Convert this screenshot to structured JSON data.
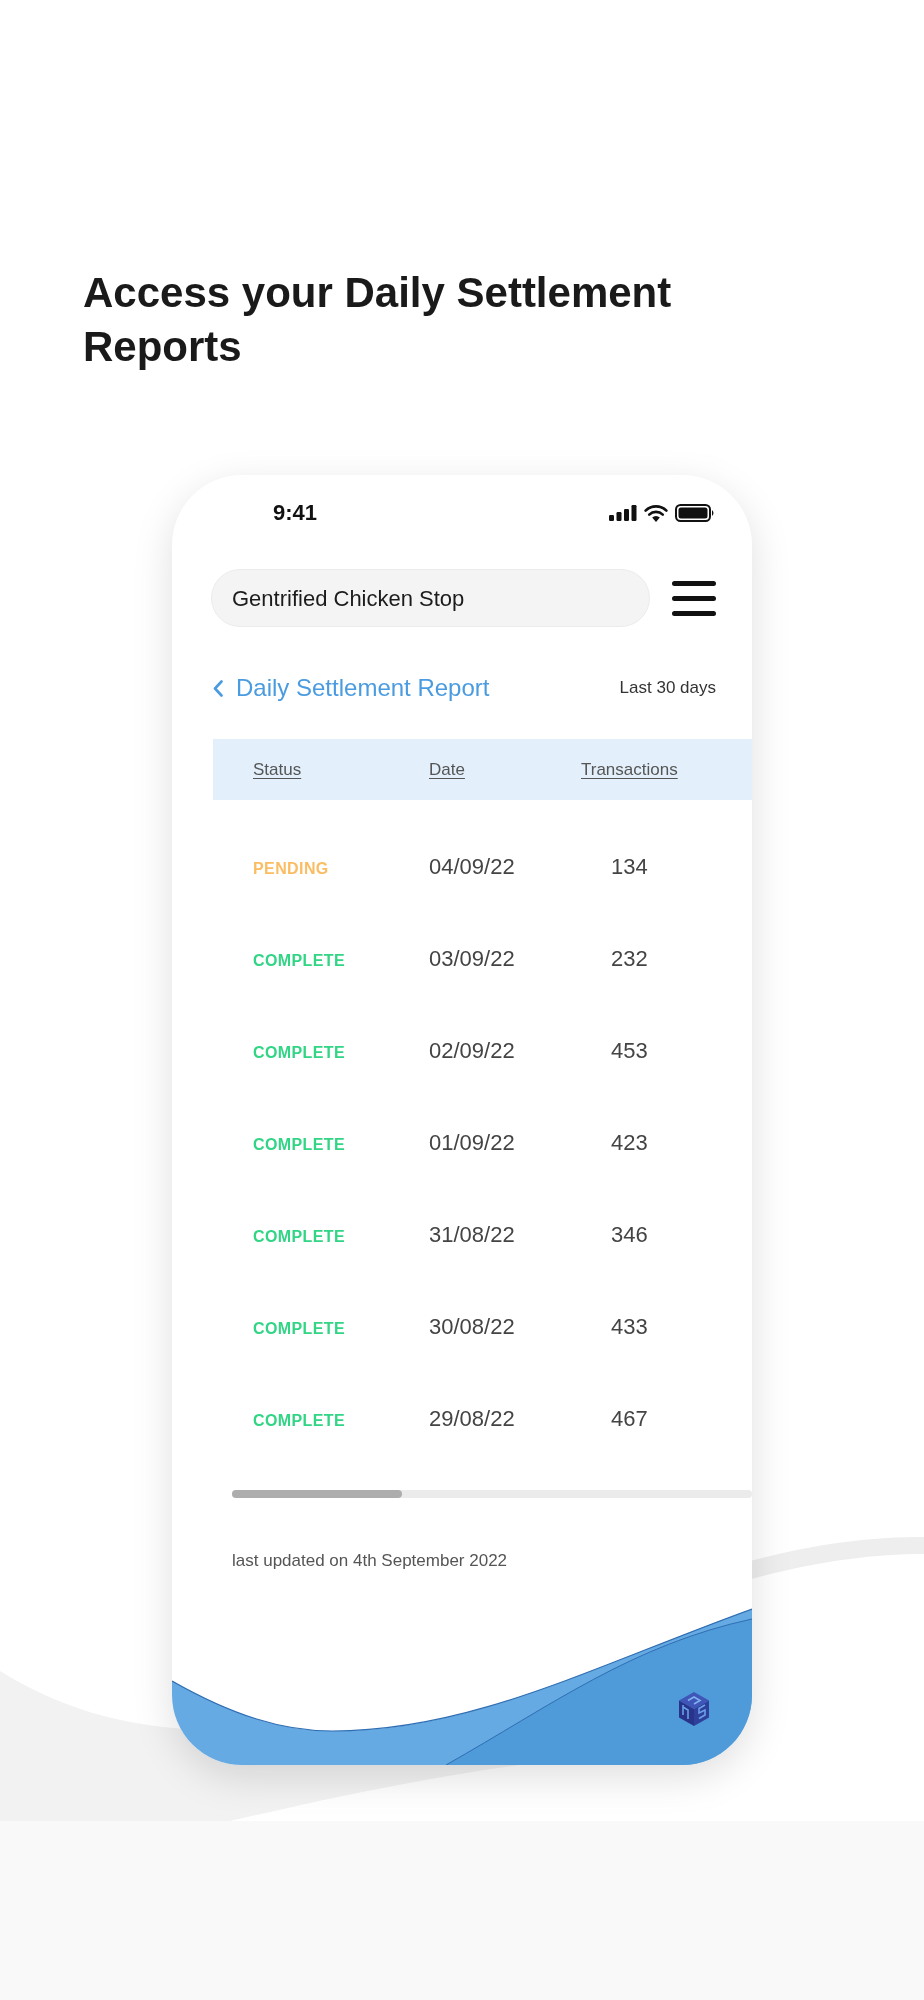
{
  "heading": "Access your Daily Settlement Reports",
  "status_bar": {
    "time": "9:41"
  },
  "store_selector": {
    "value": "Gentrified Chicken Stop"
  },
  "report_header": {
    "title": "Daily Settlement Report",
    "range": "Last 30 days"
  },
  "table": {
    "columns": [
      "Status",
      "Date",
      "Transactions"
    ],
    "rows": [
      {
        "status": "PENDING",
        "color": "#fbbd63",
        "date": "04/09/22",
        "transactions": "134"
      },
      {
        "status": "COMPLETE",
        "color": "#32d585",
        "date": "03/09/22",
        "transactions": "232"
      },
      {
        "status": "COMPLETE",
        "color": "#32d585",
        "date": "02/09/22",
        "transactions": "453"
      },
      {
        "status": "COMPLETE",
        "color": "#32d585",
        "date": "01/09/22",
        "transactions": "423"
      },
      {
        "status": "COMPLETE",
        "color": "#32d585",
        "date": "31/08/22",
        "transactions": "346"
      },
      {
        "status": "COMPLETE",
        "color": "#32d585",
        "date": "30/08/22",
        "transactions": "433"
      },
      {
        "status": "COMPLETE",
        "color": "#32d585",
        "date": "29/08/22",
        "transactions": "467"
      }
    ]
  },
  "footer_note": "last updated on 4th September 2022"
}
